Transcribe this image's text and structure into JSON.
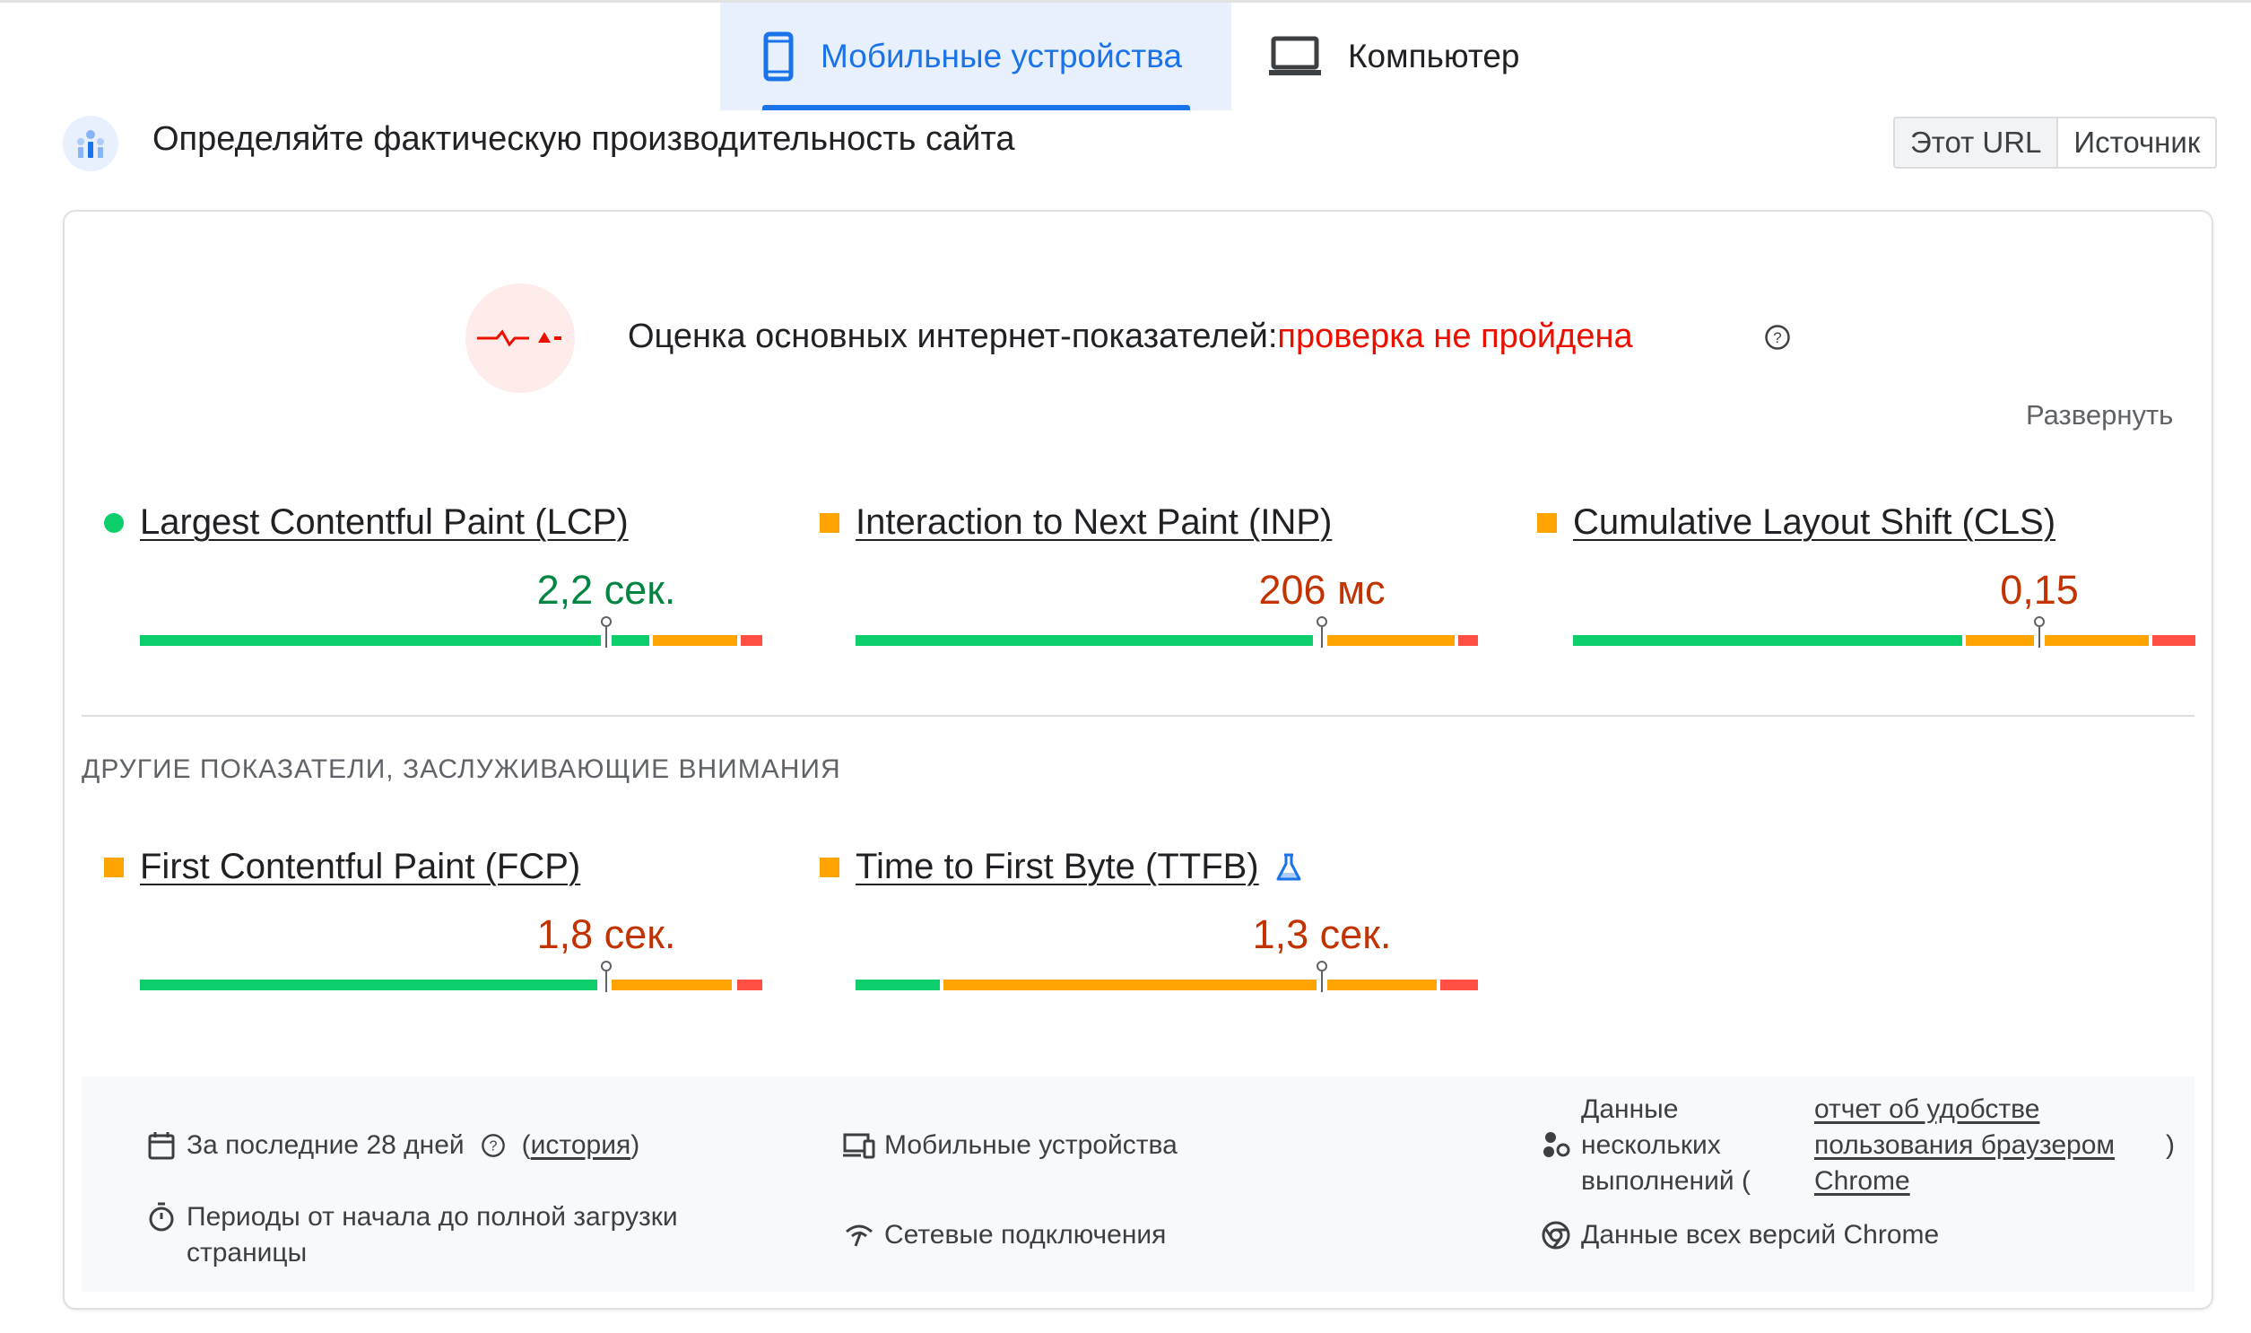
{
  "tabs": [
    {
      "label": "Мобильные устройства",
      "active": true,
      "icon": "smartphone-icon"
    },
    {
      "label": "Компьютер",
      "active": false,
      "icon": "laptop-icon"
    }
  ],
  "header": {
    "title": "Определяйте фактическую производительность сайта",
    "toggle": {
      "this_url": "Этот URL",
      "origin": "Источник"
    }
  },
  "assessment": {
    "label": "Оценка основных интернет-показателей:",
    "status": "проверка не пройдена",
    "expand": "Развернуть"
  },
  "core_metrics": [
    {
      "name": "Largest Contentful Paint (LCP)",
      "value": "2,2 сек.",
      "rating": "good",
      "indicator": "circle"
    },
    {
      "name": "Interaction to Next Paint (INP)",
      "value": "206 мс",
      "rating": "needs-improvement",
      "indicator": "square"
    },
    {
      "name": "Cumulative Layout Shift (CLS)",
      "value": "0,15",
      "rating": "needs-improvement",
      "indicator": "square"
    }
  ],
  "other_section_label": "ДРУГИЕ ПОКАЗАТЕЛИ, ЗАСЛУЖИВАЮЩИЕ ВНИМАНИЯ",
  "other_metrics": [
    {
      "name": "First Contentful Paint (FCP)",
      "value": "1,8 сек.",
      "rating": "needs-improvement",
      "indicator": "square"
    },
    {
      "name": "Time to First Byte (TTFB)",
      "value": "1,3 сек.",
      "rating": "needs-improvement",
      "indicator": "square",
      "experimental_icon": "flask-icon"
    }
  ],
  "footer": {
    "period_text": "За последние 28 дней",
    "history_open": "(",
    "history_link": "история",
    "history_close": ")",
    "device": "Мобильные устройства",
    "data_prefix_1": "Данные",
    "data_prefix_2": "нескольких",
    "data_prefix_3": "выполнений (",
    "crux_link_1": "отчет об удобстве",
    "crux_link_2": "пользования браузером",
    "crux_link_3": "Chrome",
    "crux_close": ")",
    "load_periods_1": "Периоды от начала до полной загрузки",
    "load_periods_2": "страницы",
    "network": "Сетевые подключения",
    "all_chrome": "Данные всех версий Chrome"
  },
  "colors": {
    "accent": "#1a73e8",
    "good": "#0cce6b",
    "good_text": "#018642",
    "average": "#ffa400",
    "average_text": "#c33300",
    "poor": "#ff4e42",
    "fail_text": "#eb0f00"
  }
}
